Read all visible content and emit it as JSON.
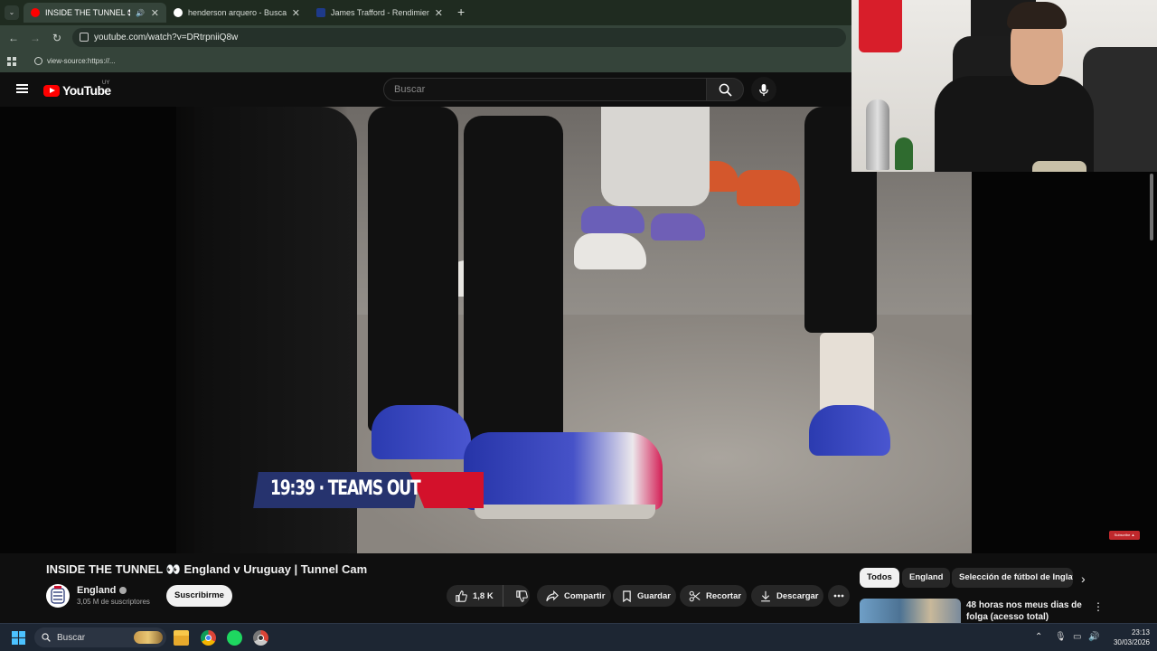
{
  "browser": {
    "tabs": [
      {
        "title": "INSIDE THE TUNNEL 👀 En",
        "active": true,
        "favicon_color": "#ff0000"
      },
      {
        "title": "henderson arquero - Buscar co",
        "active": false,
        "favicon_color": "#ffffff"
      },
      {
        "title": "James Trafford - Rendimiento p",
        "active": false,
        "favicon_color": "#1e3a8a"
      }
    ],
    "new_tab": "+",
    "url": "youtube.com/watch?v=DRtrpniiQ8w",
    "bookmark": "view-source:https://..."
  },
  "youtube": {
    "logo_text": "YouTube",
    "country": "UY",
    "search_placeholder": "Buscar"
  },
  "video": {
    "lower_third": "19:39 · TEAMS OUT",
    "sub_badge": "Subscribe ▲"
  },
  "watch": {
    "title": "INSIDE THE TUNNEL 👀 England v Uruguay | Tunnel Cam",
    "channel": "England",
    "subscribers": "3,05 M de suscriptores",
    "subscribe_label": "Suscribirme",
    "likes": "1,8 K",
    "share_label": "Compartir",
    "save_label": "Guardar",
    "clip_label": "Recortar",
    "download_label": "Descargar"
  },
  "chips": [
    "Todos",
    "England",
    "Selección de fútbol de Inglaterra"
  ],
  "recommendation": {
    "title": "48 horas nos meus dias de folga (acesso total)"
  },
  "taskbar": {
    "search_placeholder": "Buscar",
    "time": "23:13",
    "date": "30/03/2026"
  },
  "colors": {
    "yt_red": "#ff0000",
    "chrome_tab_bg": "#1f2b20",
    "chrome_toolbar": "#35443a",
    "page_bg": "#0f0f0f",
    "taskbar": "#1d2633"
  }
}
